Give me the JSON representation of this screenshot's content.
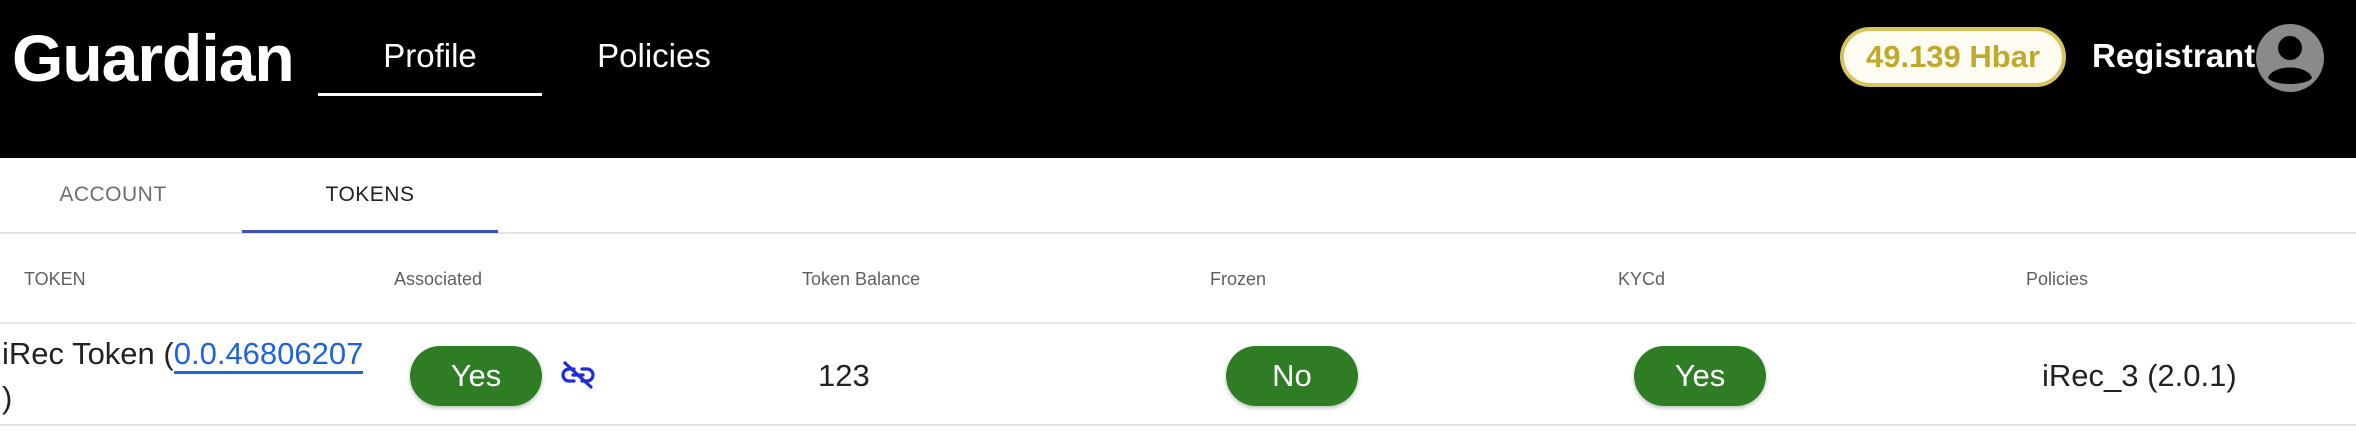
{
  "header": {
    "brand": "Guardian",
    "nav": [
      {
        "label": "Profile",
        "active": true
      },
      {
        "label": "Policies",
        "active": false
      }
    ],
    "balance": "49.139 Hbar",
    "user_role": "Registrant",
    "avatar_icon": "account-circle-icon"
  },
  "tabs": [
    {
      "label": "ACCOUNT",
      "active": false
    },
    {
      "label": "TOKENS",
      "active": true
    }
  ],
  "table": {
    "columns": [
      "TOKEN",
      "Associated",
      "Token Balance",
      "Frozen",
      "KYCd",
      "Policies"
    ],
    "rows": [
      {
        "token_name_prefix": "iRec Token (",
        "token_id": "0.0.46806207",
        "token_name_suffix": ")",
        "associated": "Yes",
        "dissociate_icon": "link-off-icon",
        "balance": "123",
        "frozen": "No",
        "kycd": "Yes",
        "policy": "iRec_3 (2.0.1)"
      }
    ]
  },
  "colors": {
    "header_bg": "#000000",
    "pill_green": "#2e7d24",
    "link_blue": "#1e63d8",
    "tab_indicator": "#3f51b5",
    "balance_gold": "#c2a82a"
  }
}
